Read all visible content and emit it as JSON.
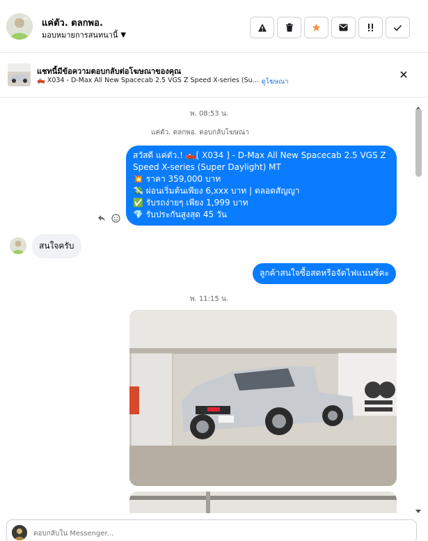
{
  "header": {
    "name": "แค่ตัว. ตลกพอ.",
    "assign_label": "มอบหมายการสนทนานี้",
    "actions": [
      "spam-icon",
      "trash-icon",
      "star-icon",
      "mail-icon",
      "flag-icon",
      "check-icon"
    ]
  },
  "ad_banner": {
    "title": "แชทนี้มีข้อความตอบกลับต่อโฆษณาของคุณ",
    "ad_text": "🛻 X034 - D-Max All New Spacecab 2.5 VGS Z Speed X-series (Su...",
    "link": "ดูโฆษณา"
  },
  "chat": {
    "timestamp_1": "พ. 08:53 น.",
    "reply_note": "แค่ตัว. ตลกพอ. ตอบกลับโฆษณา",
    "message_1": {
      "line1": "สวัสดี แค่ตัว.! 🛻[ X034 ] - D-Max All New Spacecab 2.5 VGS Z",
      "line2": "Speed X-series (Super Daylight) MT",
      "line3": "💥 ราคา 359,000 บาท",
      "line4": "💸 ผ่อนเริ่มต้นเพียง 6,xxx บาท | ตลอดสัญญา",
      "line5": "✅ รับรถง่ายๆ เพียง 1,999 บาท",
      "line6": "💎 รับประกันสูงสุด 45 วัน"
    },
    "message_2": "สนใจครับ",
    "message_3": "ลูกค้าสนใจซื้อสดหรือจัดไฟแนนซ์คะ",
    "timestamp_2": "พ. 11:15 น."
  },
  "composer": {
    "placeholder": "ตอบกลับใน Messenger..."
  },
  "colors": {
    "accent": "#0a7cff",
    "star": "#f7923a",
    "link": "#1b74e4"
  }
}
